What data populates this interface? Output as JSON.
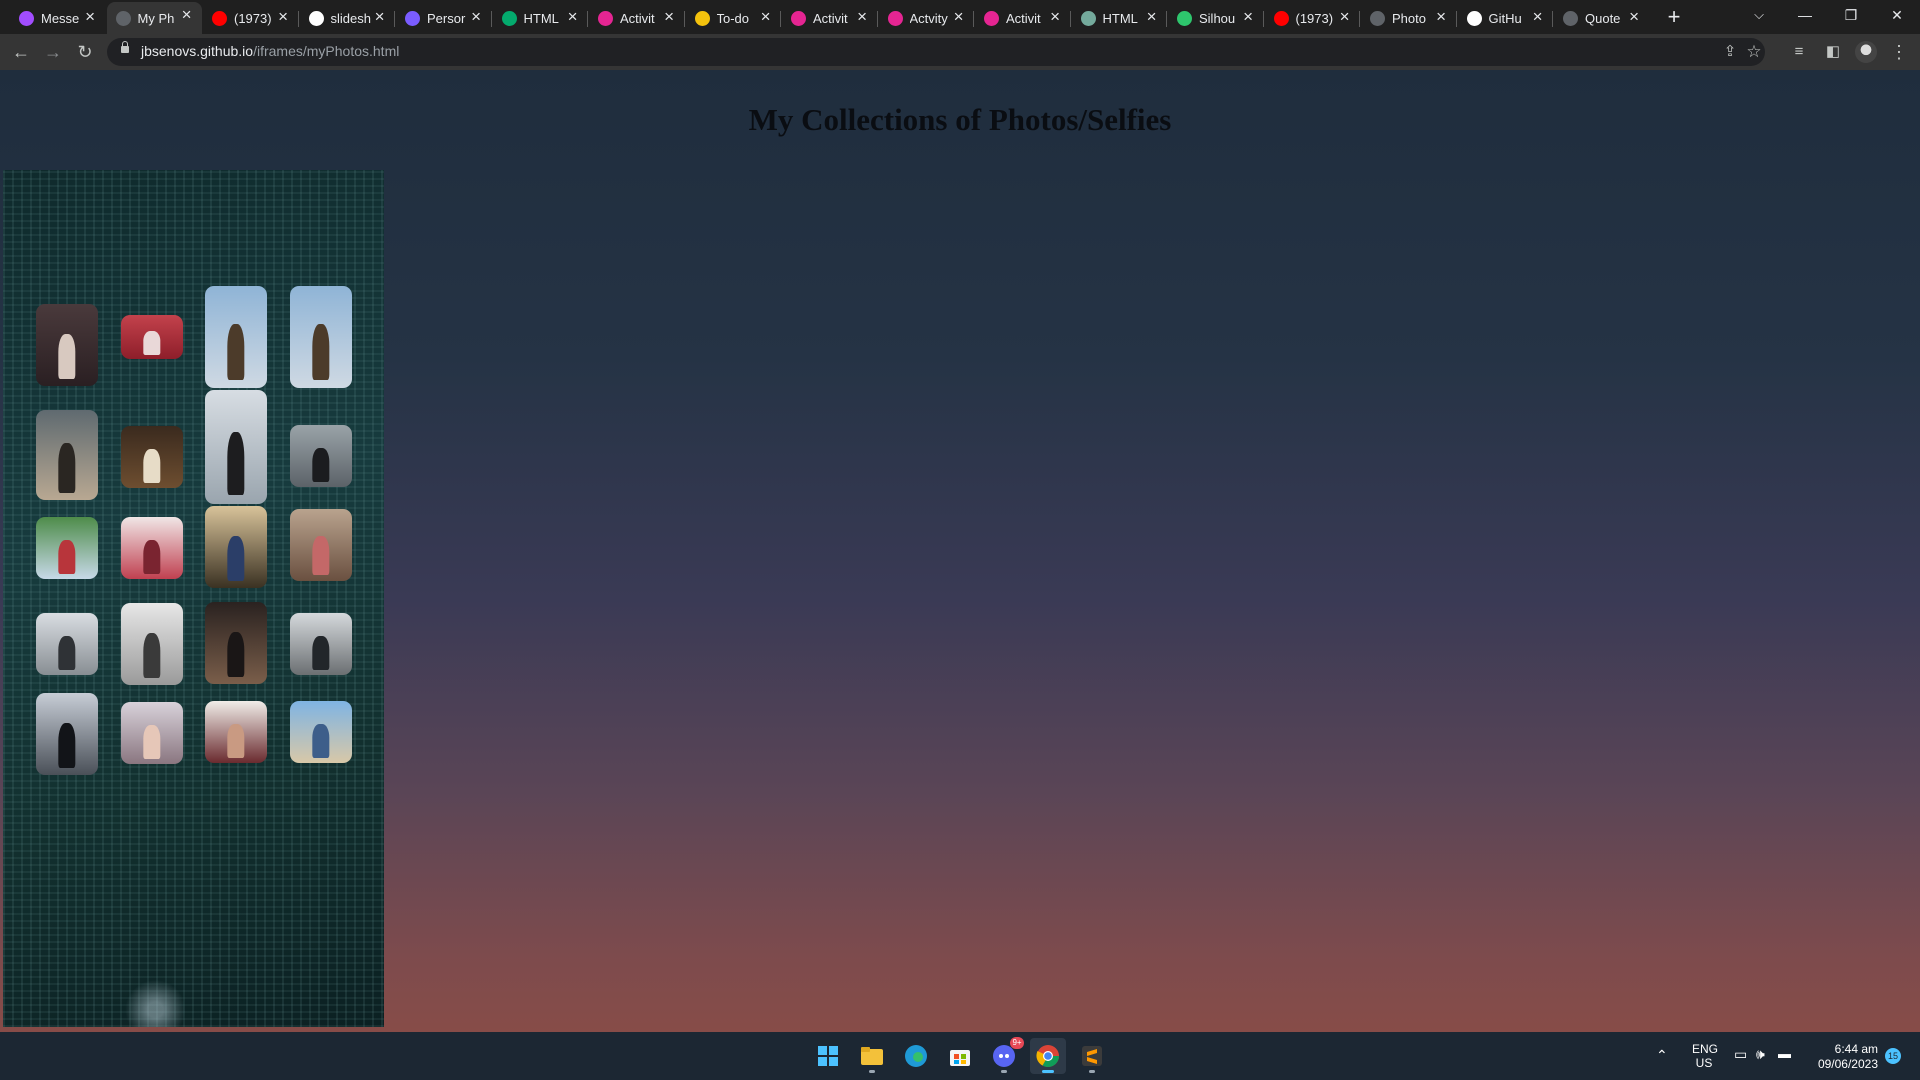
{
  "tabs": [
    {
      "title": "Messe",
      "favicon": "messenger-icon",
      "fav_color": "#a24dff"
    },
    {
      "title": "My Ph",
      "favicon": "globe-icon",
      "fav_color": "#5f6368",
      "active": true
    },
    {
      "title": "(1973)",
      "favicon": "youtube-icon",
      "fav_color": "#ff0000"
    },
    {
      "title": "slidesh",
      "favicon": "google-icon",
      "fav_color": "#ffffff"
    },
    {
      "title": "Persor",
      "favicon": "tab-app-icon",
      "fav_color": "#7a5cff"
    },
    {
      "title": "HTML",
      "favicon": "w3schools-icon",
      "fav_color": "#04aa6d"
    },
    {
      "title": "Activit",
      "favicon": "classroom-icon",
      "fav_color": "#e52592"
    },
    {
      "title": "To-do",
      "favicon": "todo-icon",
      "fav_color": "#f4c20d"
    },
    {
      "title": "Activit",
      "favicon": "classroom-icon",
      "fav_color": "#e52592"
    },
    {
      "title": "Actvity",
      "favicon": "classroom-icon",
      "fav_color": "#e52592"
    },
    {
      "title": "Activit",
      "favicon": "classroom-icon",
      "fav_color": "#e52592"
    },
    {
      "title": "HTML",
      "favicon": "openai-icon",
      "fav_color": "#74aa9c"
    },
    {
      "title": "Silhou",
      "favicon": "pixabay-icon",
      "fav_color": "#2ec66d"
    },
    {
      "title": "(1973)",
      "favicon": "youtube-icon",
      "fav_color": "#ff0000"
    },
    {
      "title": "Photo",
      "favicon": "globe-icon",
      "fav_color": "#5f6368"
    },
    {
      "title": "GitHu",
      "favicon": "github-icon",
      "fav_color": "#ffffff"
    },
    {
      "title": "Quote",
      "favicon": "globe-icon",
      "fav_color": "#5f6368"
    }
  ],
  "window_controls": {
    "dropdown": "⌵",
    "minimize": "—",
    "restore": "❐",
    "close": "✕",
    "new_tab": "+"
  },
  "address": {
    "host": "jbsenovs.github.io",
    "path": "/iframes/myPhotos.html"
  },
  "page": {
    "title": "My Collections of Photos/Selfies"
  },
  "photos": [
    {
      "label": "portrait in suit",
      "colors": [
        "#4a3a3c",
        "#2a1f22",
        "#d8c9c0"
      ]
    },
    {
      "label": "red hoodie",
      "colors": [
        "#c3424c",
        "#8e1e2a",
        "#e9d8d8"
      ]
    },
    {
      "label": "guitar by sea",
      "colors": [
        "#8fb4d6",
        "#cfd9e3",
        "#4c3b2a"
      ]
    },
    {
      "label": "guitar by sea 2",
      "colors": [
        "#8fb4d6",
        "#cfd9e3",
        "#4c3b2a"
      ]
    },
    {
      "label": "standing by tree",
      "colors": [
        "#5f6a70",
        "#b8a892",
        "#2a2622"
      ]
    },
    {
      "label": "night light",
      "colors": [
        "#3a2a1e",
        "#6e4e30",
        "#e7dcc7"
      ]
    },
    {
      "label": "silhouette clouds",
      "colors": [
        "#d7dde3",
        "#9aa5ae",
        "#1d1d1f"
      ]
    },
    {
      "label": "silhouette dusk",
      "colors": [
        "#9aa3a8",
        "#5c6268",
        "#1b1c1f"
      ]
    },
    {
      "label": "tropical",
      "colors": [
        "#4e8c4a",
        "#c7d9e8",
        "#b8353b"
      ]
    },
    {
      "label": "red shirt window",
      "colors": [
        "#f0e6e6",
        "#c04050",
        "#7a2430"
      ]
    },
    {
      "label": "window frame",
      "colors": [
        "#d8c39a",
        "#3a3122",
        "#2b3e68"
      ]
    },
    {
      "label": "wall pose",
      "colors": [
        "#b9a38e",
        "#6a5040",
        "#c46868"
      ]
    },
    {
      "label": "building",
      "colors": [
        "#d9dde2",
        "#888e93",
        "#2f3236"
      ]
    },
    {
      "label": "black and white",
      "colors": [
        "#e7e7e7",
        "#9a9a9a",
        "#3a3a3a"
      ]
    },
    {
      "label": "night tree",
      "colors": [
        "#2a2220",
        "#7a5e4a",
        "#1a1616"
      ]
    },
    {
      "label": "tree trunk",
      "colors": [
        "#d5d9dc",
        "#6b6f72",
        "#22262a"
      ]
    },
    {
      "label": "tree silhouette",
      "colors": [
        "#c7cdd6",
        "#4a5058",
        "#121418"
      ]
    },
    {
      "label": "close selfie",
      "colors": [
        "#d8d2da",
        "#8a7680",
        "#e6c7b8"
      ]
    },
    {
      "label": "maroon shirt",
      "colors": [
        "#f0ede8",
        "#6a2a2e",
        "#c99a82"
      ]
    },
    {
      "label": "beach with friend",
      "colors": [
        "#7fb4e3",
        "#d8c8a8",
        "#3d5e8a"
      ]
    }
  ],
  "taskbar": {
    "apps": [
      {
        "name": "start-icon"
      },
      {
        "name": "file-explorer-icon"
      },
      {
        "name": "edge-icon"
      },
      {
        "name": "microsoft-store-icon"
      },
      {
        "name": "discord-icon",
        "badge": "9+"
      },
      {
        "name": "chrome-icon",
        "active": true
      },
      {
        "name": "sublime-text-icon"
      }
    ],
    "lang": "ENG",
    "region": "US",
    "time": "6:44 am",
    "date": "09/06/2023",
    "notif_count": "15"
  },
  "colors": {
    "page_top": "#1f2d3d",
    "page_bottom": "#874c48",
    "tab_bg": "#1f1f1f",
    "toolbar_bg": "#353535"
  }
}
